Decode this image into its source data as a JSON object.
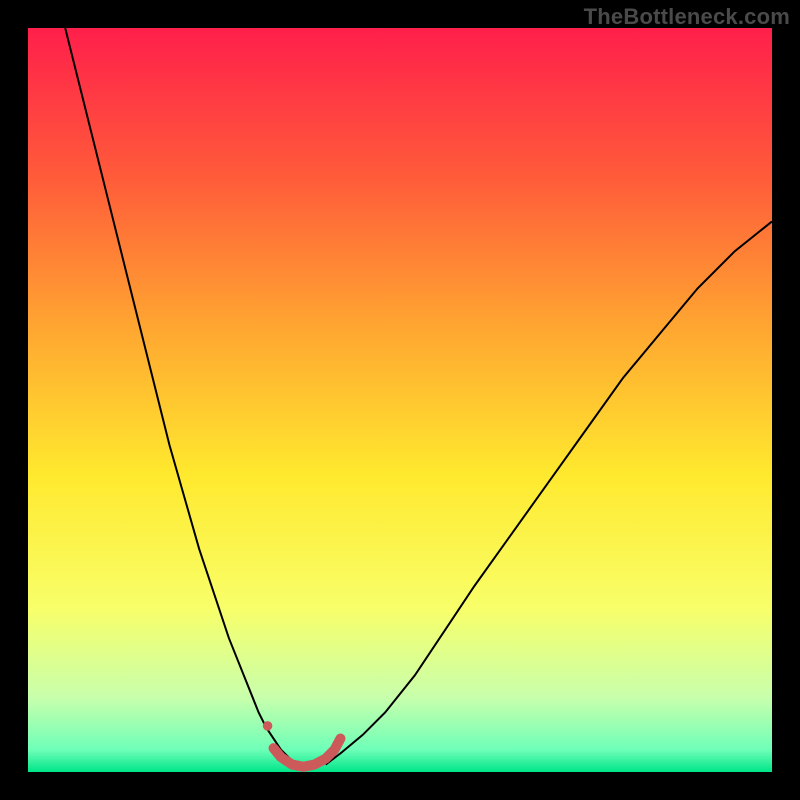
{
  "watermark": "TheBottleneck.com",
  "chart_data": {
    "type": "line",
    "title": "",
    "xlabel": "",
    "ylabel": "",
    "xlim": [
      0,
      100
    ],
    "ylim": [
      0,
      100
    ],
    "grid": false,
    "legend": false,
    "background_gradient": {
      "stops": [
        {
          "offset": 0.0,
          "color": "#ff1f4b"
        },
        {
          "offset": 0.2,
          "color": "#ff5b3a"
        },
        {
          "offset": 0.4,
          "color": "#ffa531"
        },
        {
          "offset": 0.6,
          "color": "#ffe92e"
        },
        {
          "offset": 0.78,
          "color": "#f8ff69"
        },
        {
          "offset": 0.9,
          "color": "#c8ffac"
        },
        {
          "offset": 0.97,
          "color": "#6fffb8"
        },
        {
          "offset": 1.0,
          "color": "#00e588"
        }
      ]
    },
    "series": [
      {
        "name": "curve-left",
        "stroke": "#000000",
        "stroke_width": 2,
        "x": [
          5,
          7,
          9,
          11,
          13,
          15,
          17,
          19,
          21,
          23,
          25,
          27,
          29,
          31,
          32,
          33,
          34,
          35,
          36
        ],
        "y": [
          100,
          92,
          84,
          76,
          68,
          60,
          52,
          44,
          37,
          30,
          24,
          18,
          13,
          8,
          6,
          4.5,
          3,
          2,
          1
        ]
      },
      {
        "name": "curve-right",
        "stroke": "#000000",
        "stroke_width": 2,
        "x": [
          40,
          42,
          45,
          48,
          52,
          56,
          60,
          65,
          70,
          75,
          80,
          85,
          90,
          95,
          100
        ],
        "y": [
          1,
          2.5,
          5,
          8,
          13,
          19,
          25,
          32,
          39,
          46,
          53,
          59,
          65,
          70,
          74
        ]
      },
      {
        "name": "marker-trough",
        "stroke": "#cc5a5a",
        "stroke_width": 10,
        "linecap": "round",
        "x": [
          33.0,
          34.0,
          35.5,
          37.0,
          38.5,
          40.0,
          41.2,
          42.0
        ],
        "y": [
          3.2,
          2.0,
          1.0,
          0.7,
          1.0,
          1.8,
          3.0,
          4.5
        ]
      }
    ],
    "marker_dot": {
      "x": 32.2,
      "y": 6.2,
      "r": 4.8,
      "color": "#cc5a5a"
    }
  }
}
